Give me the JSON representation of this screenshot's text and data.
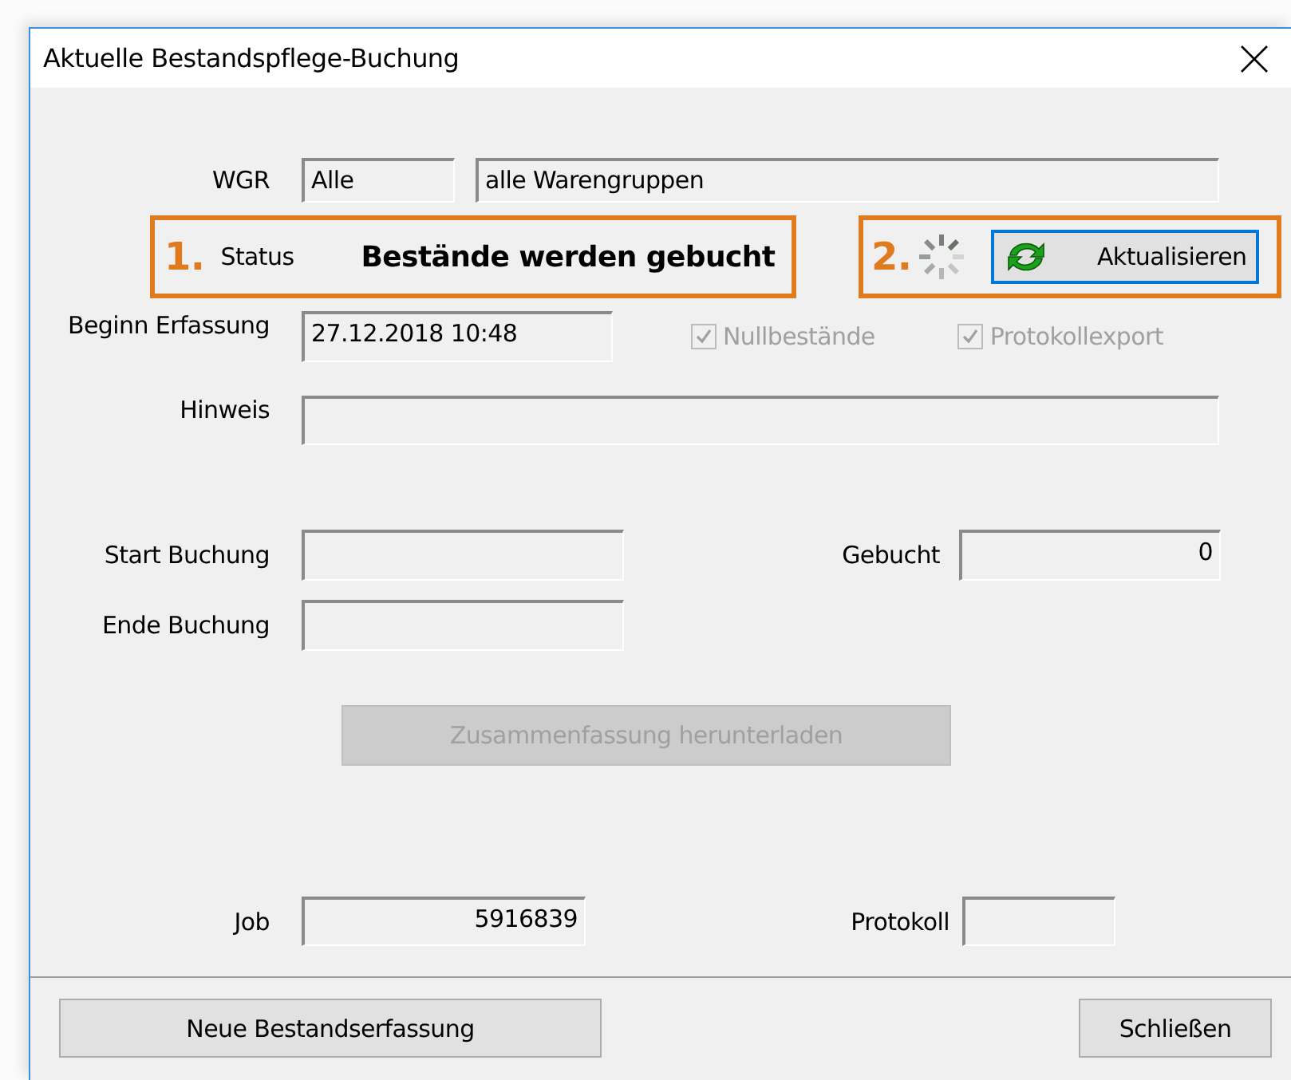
{
  "window": {
    "title": "Aktuelle Bestandspflege-Buchung"
  },
  "wgr": {
    "label": "WGR",
    "code": "Alle",
    "name": "alle Warengruppen"
  },
  "status": {
    "annotation": "1.",
    "label": "Status",
    "value": "Bestände werden gebucht"
  },
  "refresh": {
    "annotation": "2.",
    "busy": true,
    "button": {
      "label": "Aktualisieren",
      "focused": true
    }
  },
  "beginn": {
    "label": "Beginn Erfassung",
    "value": "27.12.2018 10:48"
  },
  "options": [
    {
      "label": "Nullbestände",
      "checked": true,
      "disabled": true
    },
    {
      "label": "Protokollexport",
      "checked": true,
      "disabled": true
    }
  ],
  "hinweis": {
    "label": "Hinweis"
  },
  "start_buchung": {
    "label": "Start Buchung"
  },
  "gebucht": {
    "label": "Gebucht",
    "value": "0"
  },
  "ende_buchung": {
    "label": "Ende Buchung"
  },
  "summary_button": {
    "label": "Zusammenfassung herunterladen",
    "disabled": true
  },
  "job": {
    "label": "Job",
    "value": "5916839"
  },
  "protokoll": {
    "label": "Protokoll"
  },
  "footer_buttons": [
    {
      "label": "Neue Bestandserfassung"
    },
    {
      "label": "Schließen"
    }
  ]
}
